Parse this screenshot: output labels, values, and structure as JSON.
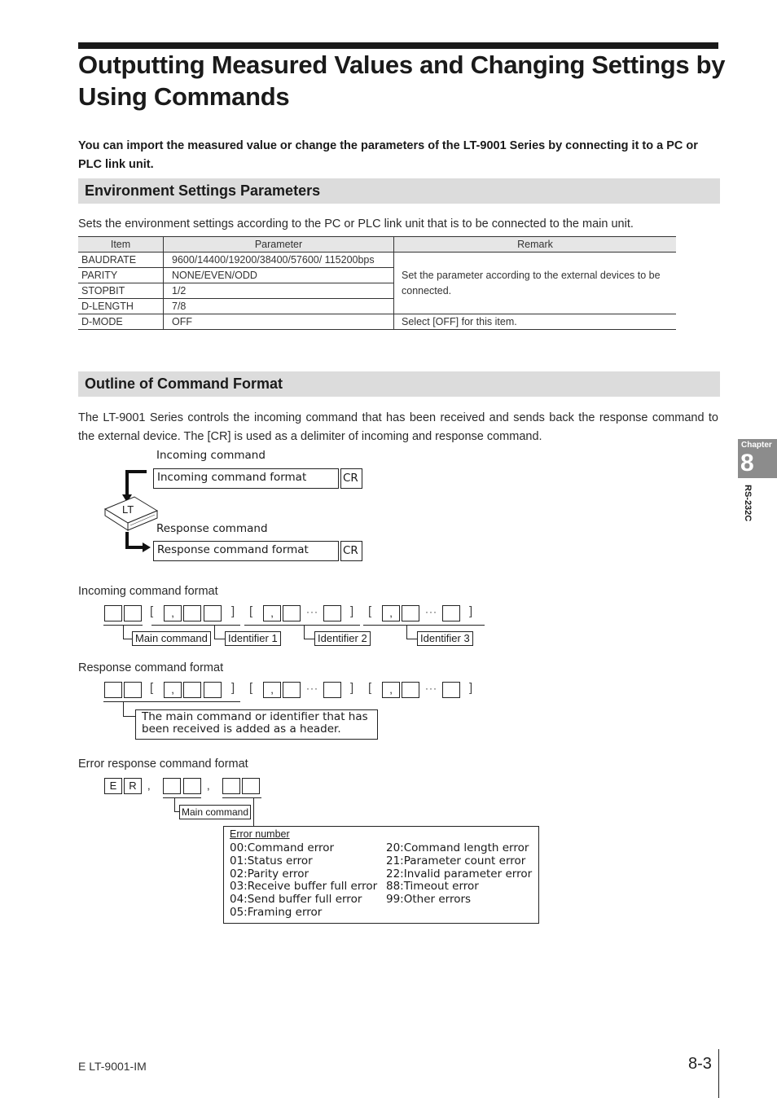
{
  "title": "Outputting Measured Values and Changing Settings by Using Commands",
  "lead": "You can import the measured value or change the parameters of the LT-9001 Series by connecting it to a PC or PLC link unit.",
  "section1": {
    "heading": "Environment Settings Parameters",
    "intro": "Sets the environment settings according to the PC or PLC link unit that is to be connected to the main unit.",
    "table": {
      "headers": [
        "Item",
        "Parameter",
        "Remark"
      ],
      "rows": [
        {
          "item": "BAUDRATE",
          "parameter": "9600/14400/19200/38400/57600/ 115200bps"
        },
        {
          "item": "PARITY",
          "parameter": "NONE/EVEN/ODD"
        },
        {
          "item": "STOPBIT",
          "parameter": "1/2"
        },
        {
          "item": "D-LENGTH",
          "parameter": "7/8"
        },
        {
          "item": "D-MODE",
          "parameter": "OFF",
          "remark": "Select [OFF] for this item."
        }
      ],
      "merged_remark": "Set the parameter according to the external devices to be connected."
    }
  },
  "section2": {
    "heading": "Outline of Command Format",
    "intro": "The LT-9001 Series controls the incoming command that has been received and sends back the response command to the external device. The [CR] is used as a delimiter of incoming and response command.",
    "flow": {
      "incoming_label": "Incoming command",
      "incoming_format": "Incoming command format",
      "device_label": "LT",
      "response_label": "Response command",
      "response_format": "Response command format",
      "cr": "CR"
    },
    "incoming_format": {
      "caption": "Incoming command format",
      "labels": [
        "Main command",
        "Identifier 1",
        "Identifier 2",
        "Identifier 3"
      ],
      "comma": ",",
      "ellipsis": "···",
      "open_bracket": "[",
      "close_bracket": "]"
    },
    "response_format": {
      "caption": "Response command format",
      "note": "The main command or identifier that has been received is added as a header."
    },
    "error_format": {
      "caption": "Error response command format",
      "fixed_chars": [
        "E",
        "R"
      ],
      "main_label": "Main command",
      "error_title": "Error number",
      "errors_left": [
        "00:Command error",
        "01:Status error",
        "02:Parity error",
        "03:Receive buffer full error",
        "04:Send buffer full error",
        "05:Framing error"
      ],
      "errors_right": [
        "20:Command length error",
        "21:Parameter count error",
        "22:Invalid parameter error",
        "88:Timeout error",
        "99:Other errors"
      ]
    }
  },
  "sidetab": {
    "chapter_label": "Chapter",
    "chapter_number": "8",
    "chapter_name": "RS-232C"
  },
  "footer": {
    "doc_id": "E LT-9001-IM",
    "page": "8-3"
  }
}
